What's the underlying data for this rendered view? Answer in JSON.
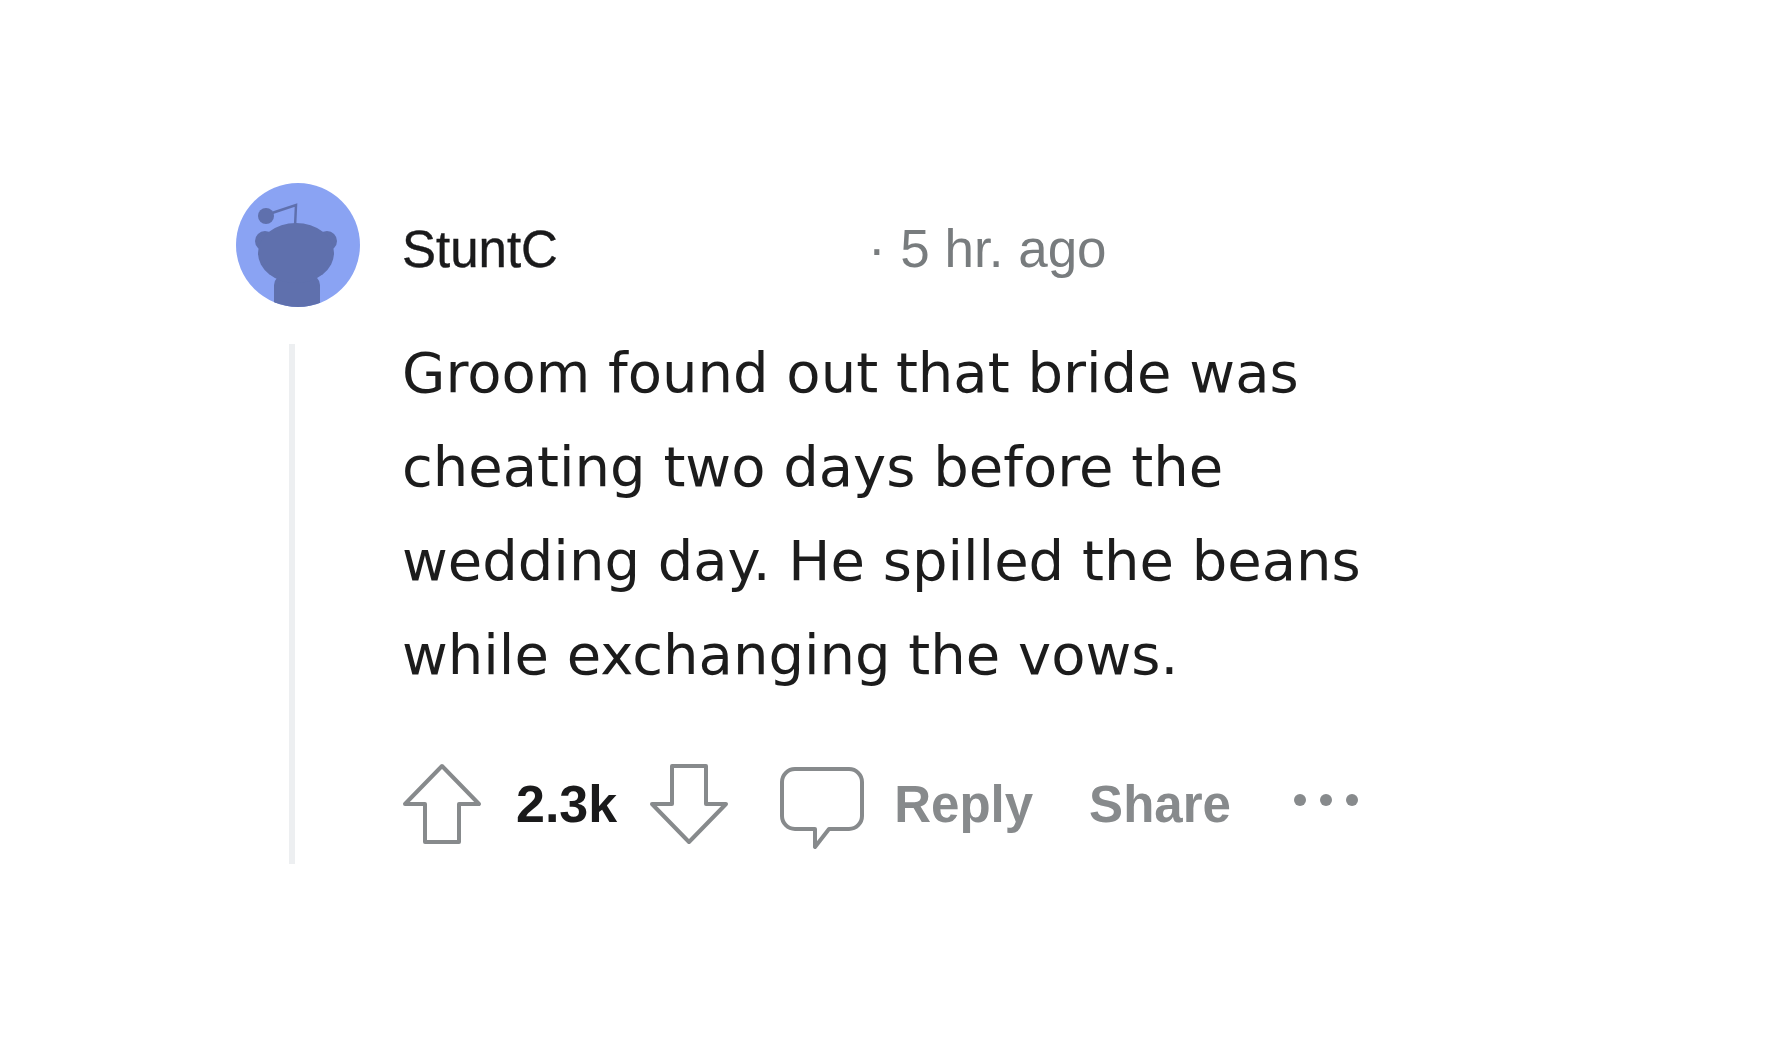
{
  "comment": {
    "author": "StuntC",
    "timestamp": "· 5 hr. ago",
    "body": "Groom found out that bride was cheating two days before the wedding day. He spilled the beans while exchanging the vows.",
    "score": "2.3k",
    "actions": [
      {
        "kind": "reply",
        "label": "Reply"
      },
      {
        "kind": "share",
        "label": "Share"
      }
    ]
  }
}
